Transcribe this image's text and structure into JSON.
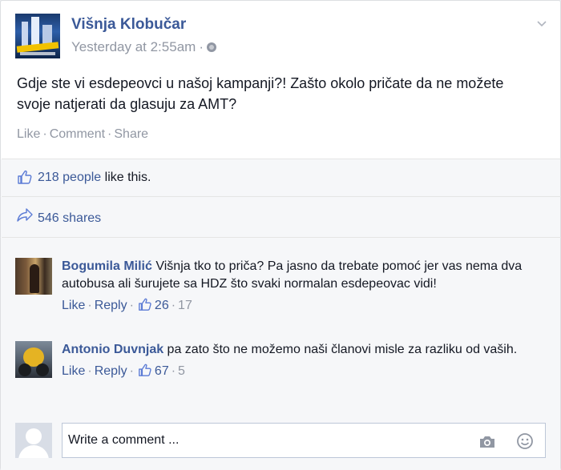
{
  "post": {
    "author": "Višnja Klobučar",
    "timestamp": "Yesterday at 2:55am",
    "meta_separator": "·",
    "privacy_icon": "globe-icon",
    "menu_icon": "chevron-down-icon",
    "text": "Gdje ste vi esdepeovci u našoj kampanji?! Zašto okolo pričate da ne možete svoje natjerati da glasuju za AMT?",
    "actions": {
      "like": "Like",
      "comment": "Comment",
      "share": "Share",
      "separator": "·"
    }
  },
  "likes": {
    "count_text": "218 people",
    "suffix": " like this."
  },
  "shares": {
    "text": "546 shares"
  },
  "comments": [
    {
      "author": "Bogumila Milić",
      "text": " Višnja tko to priča? Pa jasno da trebate pomoć jer vas nema dva autobusa ali šurujete sa HDZ što svaki normalan esdepeovac vidi!",
      "like": "Like",
      "reply": "Reply",
      "like_count": "26",
      "reply_count": "17"
    },
    {
      "author": "Antonio Duvnjak",
      "text": " pa zato što ne možemo naši članovi misle za razliku od vaših.",
      "like": "Like",
      "reply": "Reply",
      "like_count": "67",
      "reply_count": "5"
    }
  ],
  "composer": {
    "placeholder": "Write a comment ...",
    "camera_icon": "camera-icon",
    "emoji_icon": "smiley-icon"
  },
  "colors": {
    "link": "#3b5998",
    "muted": "#9197a3",
    "text": "#141823",
    "panel": "#f6f7f9"
  }
}
